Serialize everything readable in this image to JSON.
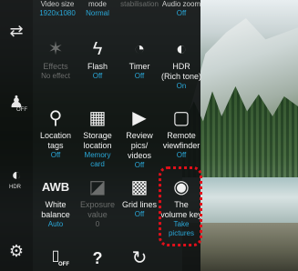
{
  "top_row": [
    {
      "label": "Video size",
      "value": "1920x1080"
    },
    {
      "label": "mode",
      "value": "Normal"
    },
    {
      "label": "stabilisation",
      "value": ""
    },
    {
      "label": "Audio zoom",
      "value": "Off"
    }
  ],
  "grid": [
    {
      "label": "Effects",
      "value": "No effect",
      "icon": "effects-icon",
      "dim": true
    },
    {
      "label": "Flash",
      "value": "Off",
      "icon": "flash-off-icon"
    },
    {
      "label": "Timer",
      "value": "Off",
      "icon": "timer-off-icon"
    },
    {
      "label": "HDR\n(Rich tone)",
      "value": "On",
      "icon": "hdr-icon"
    },
    {
      "label": "Location tags",
      "value": "Off",
      "icon": "location-off-icon"
    },
    {
      "label": "Storage location",
      "value": "Memory card",
      "icon": "memory-card-icon"
    },
    {
      "label": "Review pics/ videos",
      "value": "Off",
      "icon": "review-off-icon"
    },
    {
      "label": "Remote viewfinder",
      "value": "Off",
      "icon": "remote-viewfinder-icon"
    },
    {
      "label": "White balance",
      "value": "Auto",
      "icon": "awb-icon"
    },
    {
      "label": "Exposure value",
      "value": "0",
      "icon": "exposure-icon",
      "dim": true
    },
    {
      "label": "Grid lines",
      "value": "Off",
      "icon": "grid-lines-icon"
    },
    {
      "label": "The volume key",
      "value": "Take pictures",
      "icon": "camera-icon"
    }
  ],
  "grid_icons": {
    "effects": "✶",
    "flash": "ϟ",
    "timer": "◔",
    "hdr": "◐",
    "location": "⚲",
    "storage": "▦",
    "review": "▶",
    "remote": "▢",
    "awb": "AWB",
    "exposure": "◪",
    "grid": "▩",
    "camera": "◉"
  },
  "grid_badges": {
    "off": "OFF",
    "hdr": "HDR"
  },
  "leftbar": {
    "switch_camera": "⇄",
    "mode_badge": "OFF",
    "hdr_badge": "HDR",
    "hdr_icon": "◐",
    "settings": "⚙",
    "person": "♟"
  },
  "bottom_row": {
    "help": "?",
    "reset": "↻",
    "phone": "▯",
    "phone_badge": "OFF"
  },
  "colors": {
    "accent": "#2aa8d8",
    "highlight": "#e0101a"
  }
}
